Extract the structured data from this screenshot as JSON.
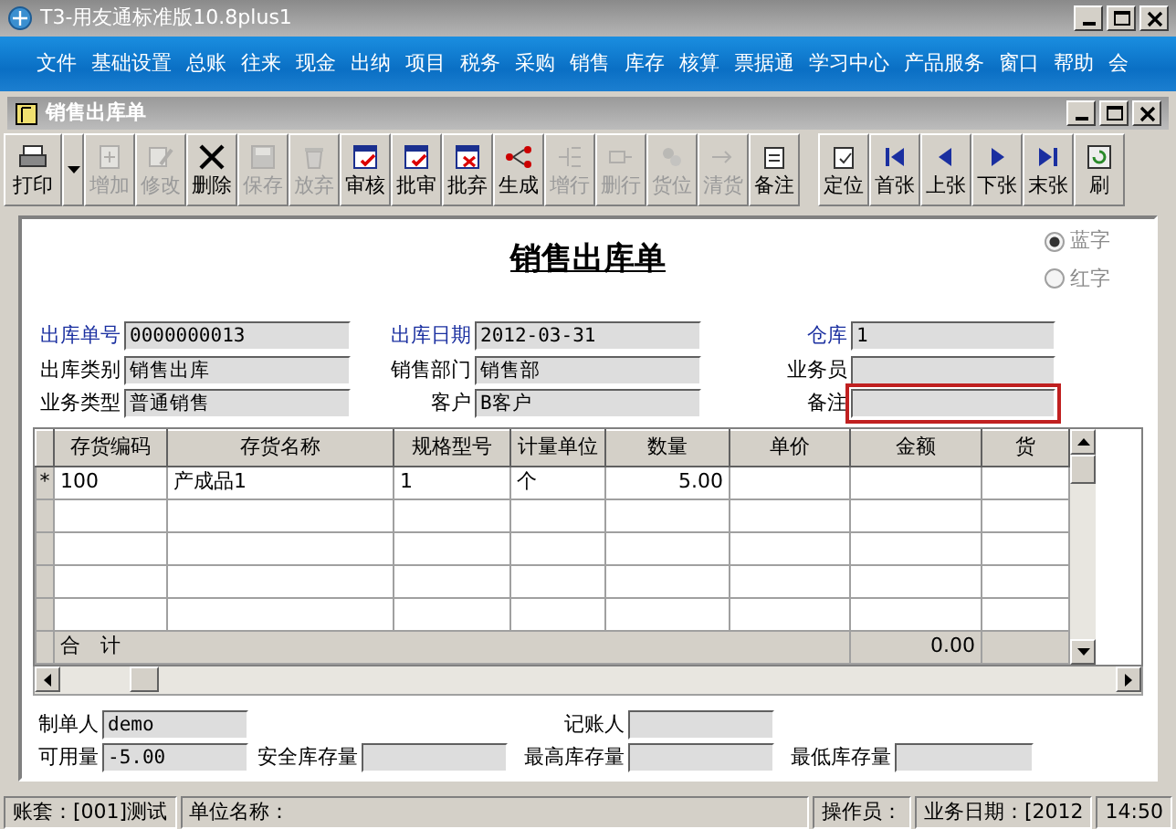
{
  "window": {
    "title": "T3-用友通标准版10.8plus1"
  },
  "menu": [
    "文件",
    "基础设置",
    "总账",
    "往来",
    "现金",
    "出纳",
    "项目",
    "税务",
    "采购",
    "销售",
    "库存",
    "核算",
    "票据通",
    "学习中心",
    "产品服务",
    "窗口",
    "帮助",
    "会"
  ],
  "document_window": {
    "title": "销售出库单"
  },
  "toolbar": [
    {
      "label": "打印",
      "disabled": false,
      "dropdown": true
    },
    {
      "label": "增加",
      "disabled": true
    },
    {
      "label": "修改",
      "disabled": true
    },
    {
      "label": "删除",
      "disabled": false
    },
    {
      "label": "保存",
      "disabled": true
    },
    {
      "label": "放弃",
      "disabled": true
    },
    {
      "label": "审核",
      "disabled": false
    },
    {
      "label": "批审",
      "disabled": false
    },
    {
      "label": "批弃",
      "disabled": false
    },
    {
      "label": "生成",
      "disabled": false
    },
    {
      "label": "增行",
      "disabled": true
    },
    {
      "label": "删行",
      "disabled": true
    },
    {
      "label": "货位",
      "disabled": true
    },
    {
      "label": "清货",
      "disabled": true
    },
    {
      "label": "备注",
      "disabled": false,
      "group_end": true
    },
    {
      "label": "定位",
      "disabled": false
    },
    {
      "label": "首张",
      "disabled": false
    },
    {
      "label": "上张",
      "disabled": false
    },
    {
      "label": "下张",
      "disabled": false
    },
    {
      "label": "末张",
      "disabled": false
    },
    {
      "label": "刷",
      "disabled": false
    }
  ],
  "form": {
    "title": "销售出库单",
    "color_options": [
      {
        "label": "蓝字",
        "selected": true
      },
      {
        "label": "红字",
        "selected": false
      }
    ],
    "header_fields": [
      {
        "label": "出库单号",
        "value": "0000000013",
        "required": true
      },
      {
        "label": "出库日期",
        "value": "2012-03-31",
        "required": true
      },
      {
        "label": "仓库",
        "value": "1",
        "required": true
      },
      {
        "label": "出库类别",
        "value": "销售出库",
        "required": false
      },
      {
        "label": "销售部门",
        "value": "销售部",
        "required": false
      },
      {
        "label": "业务员",
        "required": false
      },
      {
        "label": "业务类型",
        "value": "普通销售",
        "required": false
      },
      {
        "label": "客户",
        "value": "B客户",
        "required": false
      },
      {
        "label": "备注",
        "required": false,
        "highlighted": true
      }
    ],
    "table": {
      "columns": [
        "存货编码",
        "存货名称",
        "规格型号",
        "计量单位",
        "数量",
        "单价",
        "金额",
        "货"
      ],
      "rows": [
        {
          "marker": "*",
          "cells": [
            "100",
            "产成品1",
            "1",
            "个",
            "5.00",
            "",
            ""
          ]
        },
        {
          "cells": [
            "",
            "",
            "",
            "",
            "",
            "",
            ""
          ]
        },
        {
          "cells": [
            "",
            "",
            "",
            "",
            "",
            "",
            ""
          ]
        },
        {
          "cells": [
            "",
            "",
            "",
            "",
            "",
            "",
            ""
          ]
        },
        {
          "cells": [
            "",
            "",
            "",
            "",
            "",
            "",
            ""
          ]
        }
      ],
      "total": {
        "label": "合　计",
        "amount": "0.00"
      }
    },
    "footer_fields": [
      {
        "label": "制单人",
        "value": "demo"
      },
      {
        "label": "记账人"
      },
      {
        "label": "可用量",
        "value": "-5.00"
      },
      {
        "label": "安全库存量"
      },
      {
        "label": "最高库存量"
      },
      {
        "label": "最低库存量"
      }
    ]
  },
  "status_bar": [
    "账套：[001]测试",
    "单位名称：",
    "操作员：",
    "业务日期：[2012",
    "14:50"
  ]
}
